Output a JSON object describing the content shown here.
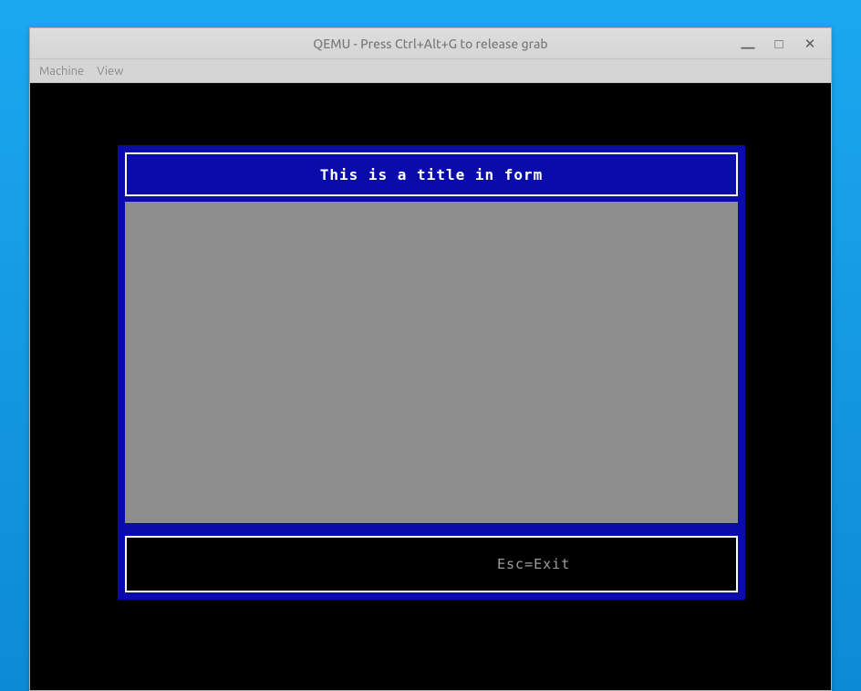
{
  "window": {
    "title": "QEMU - Press Ctrl+Alt+G to release grab"
  },
  "menubar": {
    "machine": "Machine",
    "view": "View"
  },
  "controls": {
    "minimize": "—",
    "maximize": "□",
    "close": "✕"
  },
  "form": {
    "title": "This is a title in form",
    "footer": "Esc=Exit"
  }
}
